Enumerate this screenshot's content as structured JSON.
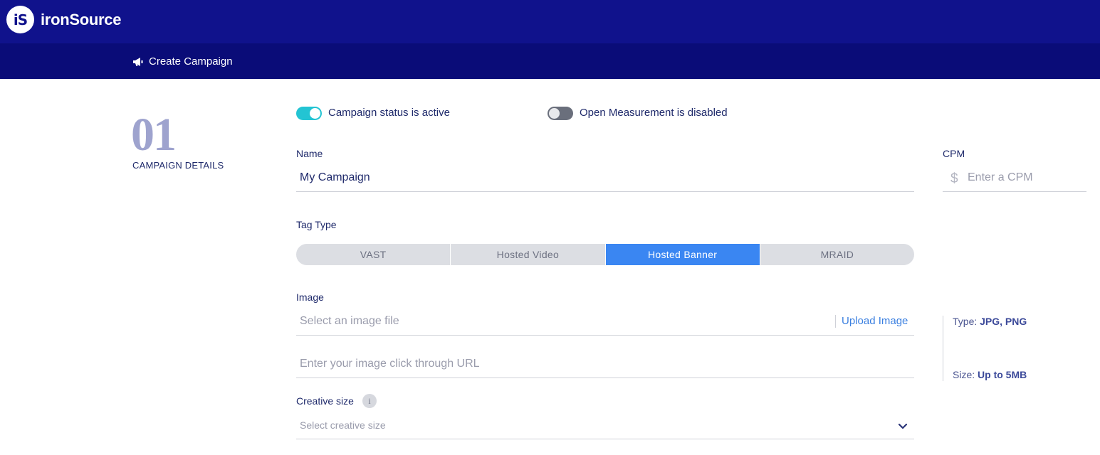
{
  "header": {
    "brand_logo": "iS",
    "brand_name": "ironSource",
    "colors": {
      "topbar": "#10128c",
      "subbar": "#0a0c78"
    }
  },
  "breadcrumb": {
    "icon": "megaphone-icon",
    "label": "Create Campaign"
  },
  "step": {
    "number": "01",
    "label": "CAMPAIGN DETAILS"
  },
  "toggles": [
    {
      "label": "Campaign status is active",
      "state": "on",
      "color": "#23c4d3"
    },
    {
      "label": "Open Measurement is disabled",
      "state": "off",
      "color": "#6a6f7c"
    }
  ],
  "form": {
    "name": {
      "label": "Name",
      "value": "My Campaign"
    },
    "cpm": {
      "label": "CPM",
      "currency_symbol": "$",
      "placeholder": "Enter a CPM"
    },
    "tag_type": {
      "label": "Tag Type",
      "options": [
        "VAST",
        "Hosted Video",
        "Hosted Banner",
        "MRAID"
      ],
      "selected": "Hosted Banner",
      "accent": "#3a86f2"
    },
    "image": {
      "label": "Image",
      "file_placeholder": "Select an image file",
      "upload_label": "Upload Image",
      "url_placeholder": "Enter your image click through URL"
    },
    "image_info": {
      "type_label": "Type:",
      "type_value": "JPG, PNG",
      "size_label": "Size:",
      "size_value": "Up to 5MB"
    },
    "creative_size": {
      "label": "Creative size",
      "info_icon": "i",
      "placeholder": "Select creative size"
    }
  }
}
